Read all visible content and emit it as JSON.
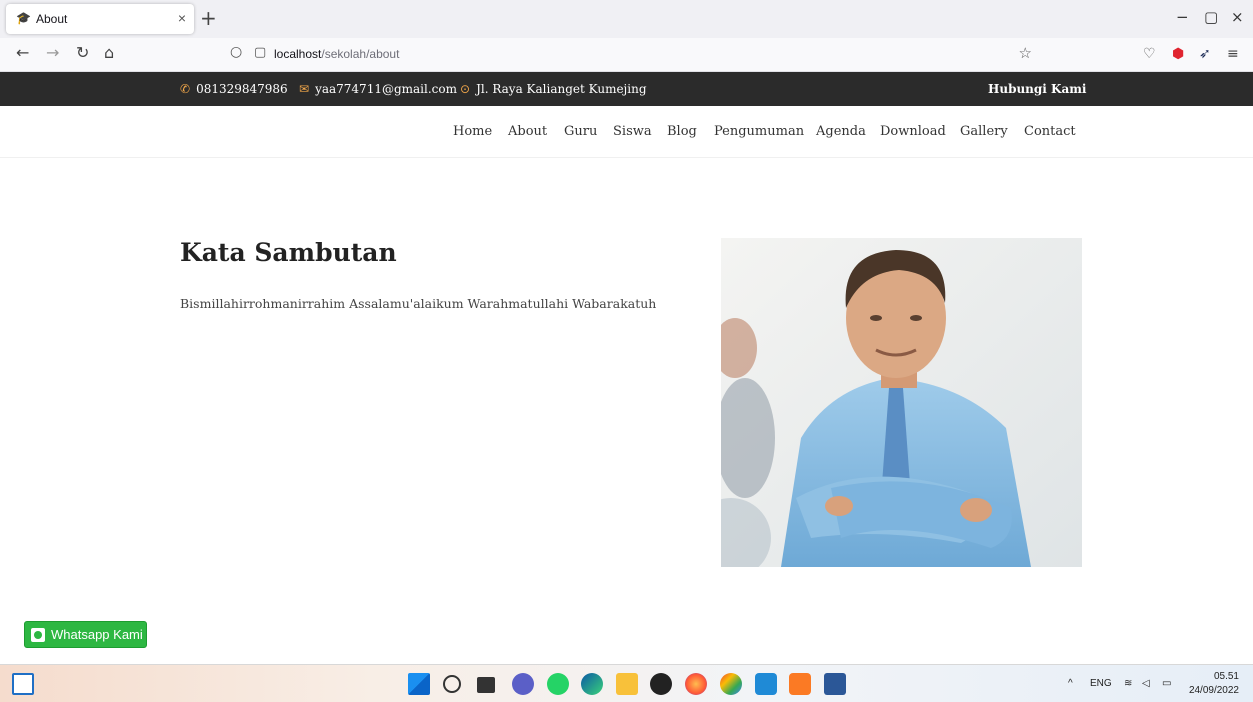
{
  "browser": {
    "tab_title": "About",
    "tab_close": "×",
    "new_tab": "+",
    "url_host": "localhost",
    "url_path": "/sekolah/about",
    "window_controls": [
      "−",
      "▢",
      "×"
    ]
  },
  "site": {
    "topbar": {
      "phone": "081329847986",
      "email": "yaa774711@gmail.com",
      "address": "Jl. Raya Kalianget Kumejing",
      "contact_link": "Hubungi Kami"
    },
    "menu": [
      "Home",
      "About",
      "Guru",
      "Siswa",
      "Blog",
      "Pengumuman",
      "Agenda",
      "Download",
      "Gallery",
      "Contact"
    ],
    "about": {
      "heading": "Kata Sambutan",
      "intro": "Bismillahirrohmanirrahim Assalamu'alaikum Warahmatullahi Wabarakatuh"
    },
    "whatsapp_button": "Whatsapp Kami"
  },
  "taskbar": {
    "language": "ENG",
    "time": "05.51",
    "date": "24/09/2022"
  },
  "colors": {
    "topbar_bg": "#2b2b2b",
    "topbar_icon": "#f0a64a",
    "whatsapp_green": "#2db742"
  }
}
